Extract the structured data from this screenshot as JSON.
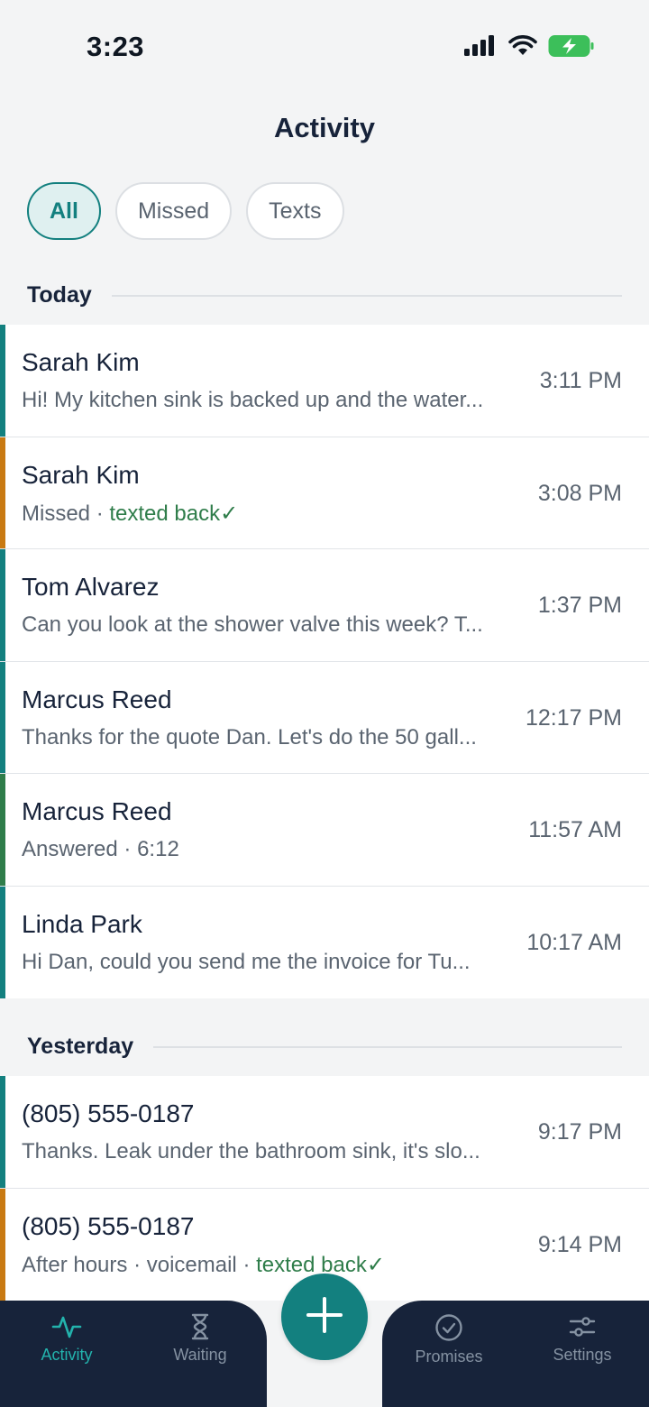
{
  "status_bar": {
    "time": "3:23"
  },
  "header": {
    "title": "Activity"
  },
  "filters": [
    {
      "label": "All",
      "active": true
    },
    {
      "label": "Missed",
      "active": false
    },
    {
      "label": "Texts",
      "active": false
    }
  ],
  "sections": {
    "today": {
      "title": "Today",
      "items": [
        {
          "name": "Sarah Kim",
          "preview": "Hi! My kitchen sink is backed up and the water...",
          "time": "3:11 PM",
          "accent": "#13807f"
        },
        {
          "name": "Sarah Kim",
          "status": "Missed",
          "texted_back": "texted back",
          "check": "✓",
          "time": "3:08 PM",
          "accent": "#c97a12"
        },
        {
          "name": "Tom Alvarez",
          "preview": "Can you look at the shower valve this week? T...",
          "time": "1:37 PM",
          "accent": "#13807f"
        },
        {
          "name": "Marcus Reed",
          "preview": "Thanks for the quote Dan. Let's do the 50 gall...",
          "time": "12:17 PM",
          "accent": "#13807f"
        },
        {
          "name": "Marcus Reed",
          "status": "Answered",
          "duration": "6:12",
          "time": "11:57 AM",
          "accent": "#2f7d4a"
        },
        {
          "name": "Linda Park",
          "preview": "Hi Dan, could you send me the invoice for Tu...",
          "time": "10:17 AM",
          "accent": "#13807f"
        }
      ]
    },
    "yesterday": {
      "title": "Yesterday",
      "items": [
        {
          "name": "(805) 555-0187",
          "preview": "Thanks. Leak under the bathroom sink, it's slo...",
          "time": "9:17 PM",
          "accent": "#13807f"
        },
        {
          "name": "(805) 555-0187",
          "status": "After hours",
          "voicemail": "voicemail",
          "texted_back": "texted back",
          "check": "✓",
          "time": "9:14 PM",
          "accent": "#c97a12"
        }
      ]
    }
  },
  "separator": "·",
  "bottom_nav": {
    "items": [
      {
        "label": "Activity",
        "icon": "activity-pulse-icon",
        "active": true
      },
      {
        "label": "Waiting",
        "icon": "hourglass-icon",
        "active": false
      },
      {
        "label": "Promises",
        "icon": "check-circle-icon",
        "active": false
      },
      {
        "label": "Settings",
        "icon": "sliders-icon",
        "active": false
      }
    ],
    "fab_icon": "plus-icon"
  },
  "colors": {
    "primary": "#13807f",
    "nav_active": "#23b3ad",
    "nav_bg": "#17233a",
    "missed": "#c97a12",
    "answered": "#2f7d4a",
    "battery": "#3cbf5a"
  }
}
